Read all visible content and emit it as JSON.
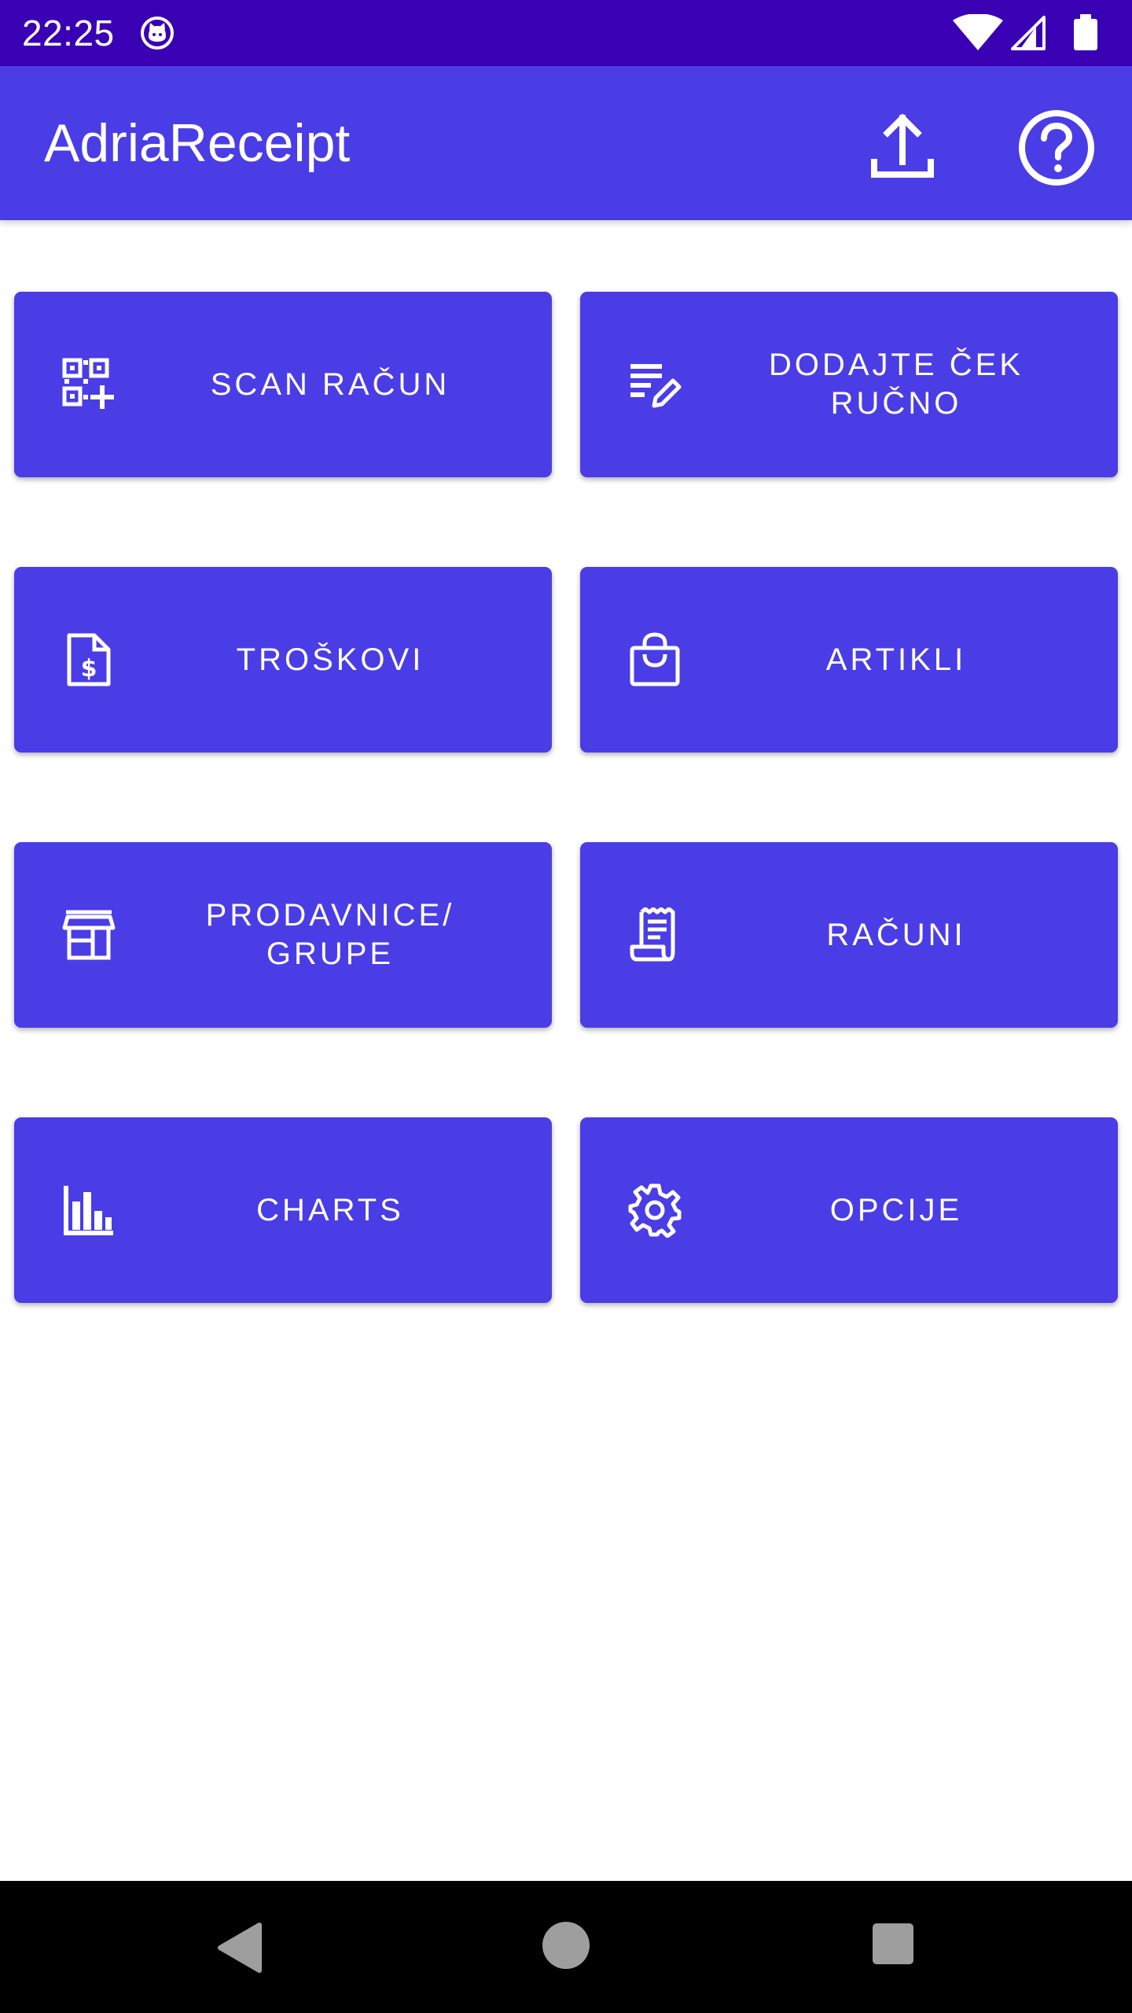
{
  "status_bar": {
    "time": "22:25",
    "icons": [
      "cat-notification-icon",
      "wifi-icon",
      "cell-signal-icon",
      "battery-icon"
    ]
  },
  "app_bar": {
    "title": "AdriaReceipt",
    "actions": [
      "upload-icon",
      "help-icon"
    ]
  },
  "tiles": [
    {
      "label": "SCAN RAČUN",
      "icon": "qr-code-add-icon"
    },
    {
      "label": "DODAJTE ČEK\nRUČNO",
      "icon": "edit-list-icon"
    },
    {
      "label": "TROŠKOVI",
      "icon": "dollar-document-icon"
    },
    {
      "label": "ARTIKLI",
      "icon": "shopping-bag-icon"
    },
    {
      "label": "PRODAVNICE/\nGRUPE",
      "icon": "storefront-icon"
    },
    {
      "label": "RAČUNI",
      "icon": "receipt-icon"
    },
    {
      "label": "CHARTS",
      "icon": "bar-chart-icon"
    },
    {
      "label": "OPCIJE",
      "icon": "gear-icon"
    }
  ],
  "nav_bar": {
    "buttons": [
      "back-icon",
      "home-icon",
      "recents-icon"
    ]
  },
  "colors": {
    "status_bar": "#3a00b4",
    "primary": "#4a3de6",
    "on_primary": "#ffffff",
    "background": "#ffffff",
    "nav_bar": "#000000",
    "nav_icons": "#9e9e9e"
  }
}
